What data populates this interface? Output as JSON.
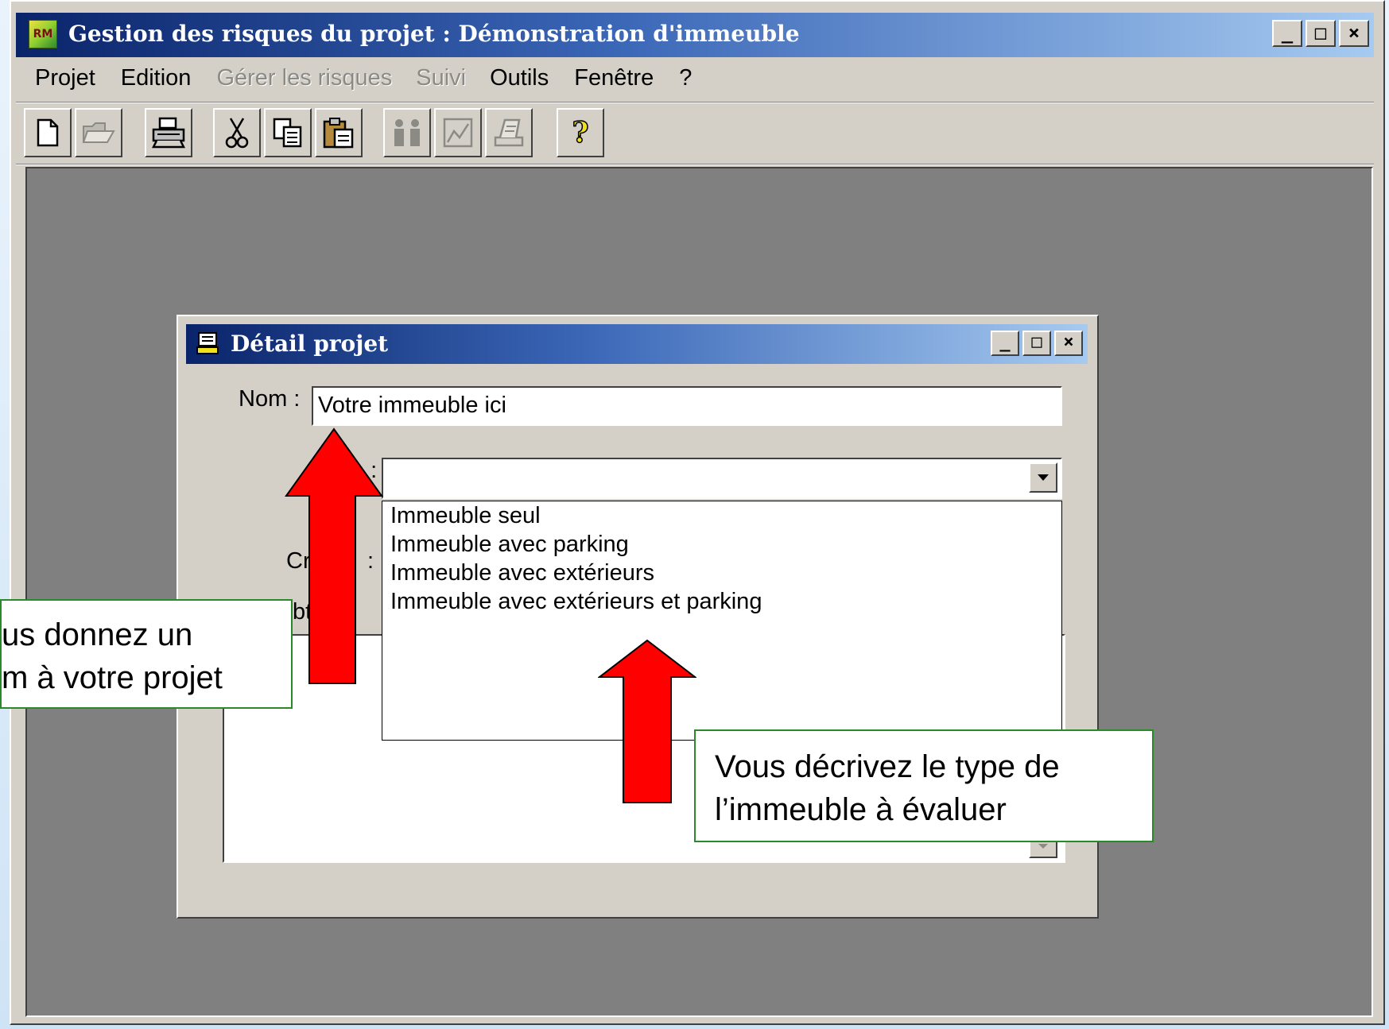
{
  "window": {
    "title": "Gestion des risques du projet : Démonstration d'immeuble",
    "app_icon_text": "RM",
    "caption_buttons": [
      "_",
      "□",
      "×"
    ]
  },
  "menu": {
    "items": [
      {
        "label": "Projet",
        "enabled": true
      },
      {
        "label": "Edition",
        "enabled": true
      },
      {
        "label": "Gérer les risques",
        "enabled": false
      },
      {
        "label": "Suivi",
        "enabled": false
      },
      {
        "label": "Outils",
        "enabled": true
      },
      {
        "label": "Fenêtre",
        "enabled": true
      },
      {
        "label": "?",
        "enabled": true
      }
    ]
  },
  "toolbar": {
    "buttons": [
      {
        "icon": "new-document-icon",
        "enabled": true
      },
      {
        "icon": "open-folder-icon",
        "enabled": false
      },
      {
        "icon": "print-icon",
        "enabled": true
      },
      {
        "icon": "cut-icon",
        "enabled": true
      },
      {
        "icon": "copy-icon",
        "enabled": true
      },
      {
        "icon": "paste-icon",
        "enabled": true
      },
      {
        "icon": "people-icon",
        "enabled": false
      },
      {
        "icon": "chart-icon",
        "enabled": false
      },
      {
        "icon": "report-icon",
        "enabled": false
      },
      {
        "icon": "help-icon",
        "enabled": true
      }
    ],
    "help_glyph": "?"
  },
  "dialog": {
    "title": "Détail projet",
    "caption_buttons": [
      "_",
      "□",
      "×"
    ],
    "name_label": "Nom :",
    "name_value": "Votre immeuble ici",
    "type_label_fragment": "e :",
    "creation_label_fragment": "Cr",
    "colon": ":",
    "obs_label_fragment": "bt",
    "type_value": "",
    "type_options": [
      "Immeuble seul",
      "Immeuble avec parking",
      "Immeuble avec extérieurs",
      "Immeuble avec extérieurs et parking"
    ]
  },
  "callouts": {
    "left": {
      "line1": "us donnez un",
      "line2": "m à votre projet"
    },
    "right": {
      "line1": "Vous décrivez le type de",
      "line2": "l’immeuble à évaluer"
    }
  },
  "colors": {
    "arrow_fill": "#ff0000",
    "callout_border": "#2a8a2a",
    "titlebar_start": "#0a246a",
    "titlebar_end": "#a6caf0",
    "workspace": "#808080"
  }
}
